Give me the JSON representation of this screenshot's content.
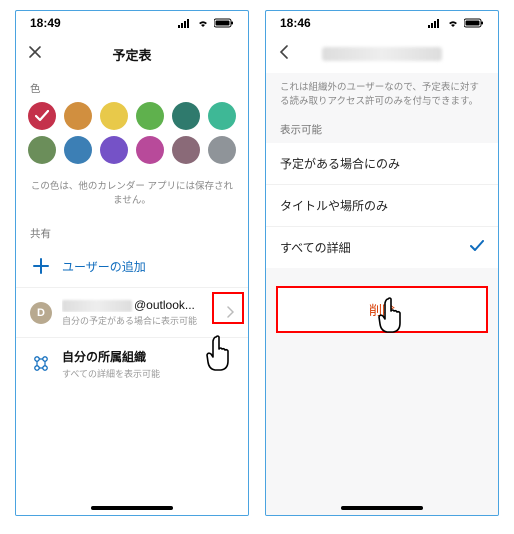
{
  "left": {
    "time": "18:49",
    "title": "予定表",
    "color_section": "色",
    "colors": [
      {
        "hex": "#c4314b",
        "selected": true
      },
      {
        "hex": "#d18f3f",
        "selected": false
      },
      {
        "hex": "#e8c94a",
        "selected": false
      },
      {
        "hex": "#5fb14d",
        "selected": false
      },
      {
        "hex": "#2f7a6d",
        "selected": false
      },
      {
        "hex": "#3eb896",
        "selected": false
      },
      {
        "hex": "#6b8e5a",
        "selected": false
      },
      {
        "hex": "#3c7fb5",
        "selected": false
      },
      {
        "hex": "#7552c7",
        "selected": false
      },
      {
        "hex": "#b84a9a",
        "selected": false
      },
      {
        "hex": "#8a6a78",
        "selected": false
      },
      {
        "hex": "#8f9499",
        "selected": false
      }
    ],
    "color_note": "この色は、他のカレンダー アプリには保存されません。",
    "share_section": "共有",
    "add_user": "ユーザーの追加",
    "user_email_suffix": "@outlook...",
    "user_sub": "自分の予定がある場合に表示可能",
    "org_title": "自分の所属組織",
    "org_sub": "すべての詳細を表示可能"
  },
  "right": {
    "time": "18:46",
    "permission_note": "これは組織外のユーザーなので、予定表に対する読み取りアクセス許可のみを付与できます。",
    "perm_section": "表示可能",
    "perm1": "予定がある場合にのみ",
    "perm2": "タイトルや場所のみ",
    "perm3": "すべての詳細",
    "delete": "削除"
  }
}
